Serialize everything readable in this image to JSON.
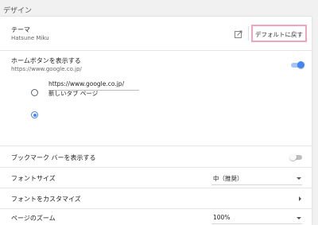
{
  "section": {
    "title": "デザイン"
  },
  "theme": {
    "label": "テーマ",
    "value": "Hatsune Miku",
    "reset_label": "デフォルトに戻す"
  },
  "home_button": {
    "label": "ホームボタンを表示する",
    "url": "https://www.google.co.jp/",
    "enabled": true,
    "options": [
      {
        "label": "新しいタブ ページ",
        "selected": false
      },
      {
        "value": "https://www.google.co.jp/",
        "selected": true
      }
    ]
  },
  "bookmarks_bar": {
    "label": "ブックマーク バーを表示する",
    "enabled": false
  },
  "font_size": {
    "label": "フォントサイズ",
    "value": "中（推奨）"
  },
  "customize_fonts": {
    "label": "フォントをカスタマイズ"
  },
  "page_zoom": {
    "label": "ページのズーム",
    "value": "100%"
  },
  "colors": {
    "accent": "#4285f4",
    "toggle_on_track": "#a7c3f7",
    "toggle_off_track": "#bdbdbd",
    "toggle_off_knob": "#fafafa",
    "highlight": "#f3a3c2"
  }
}
